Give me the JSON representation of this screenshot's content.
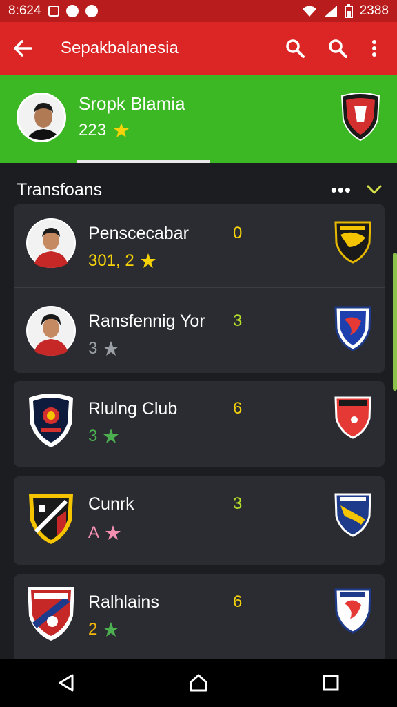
{
  "status_bar": {
    "time": "8:624",
    "right_text": "2388"
  },
  "app_bar": {
    "title": "Sepakbalanesia"
  },
  "profile": {
    "name": "Sropk Blamia",
    "rating": "223"
  },
  "section": {
    "title": "Transfoans"
  },
  "items": [
    {
      "name": "Penscecabar",
      "rating": "301, 2",
      "number": "0",
      "rating_color": "#f5d20a",
      "star_color": "#f5d20a",
      "number_color": "#f5d20a"
    },
    {
      "name": "Ransfennig Yor",
      "rating": "3",
      "number": "3",
      "rating_color": "#9aa0a6",
      "star_color": "#9aa0a6",
      "number_color": "#b5e02a"
    },
    {
      "name": "Rlulng Club",
      "rating": "3",
      "number": "6",
      "rating_color": "#4caf50",
      "star_color": "#4caf50",
      "number_color": "#f5d20a"
    },
    {
      "name": "Cunrk",
      "rating": "A",
      "number": "3",
      "rating_color": "#f48fb1",
      "star_color": "#f48fb1",
      "number_color": "#b5e02a"
    },
    {
      "name": "Ralhlains",
      "rating": "2",
      "number": "6",
      "rating_color": "#f5b70a",
      "star_color": "#4caf50",
      "number_color": "#f5d20a"
    }
  ],
  "colors": {
    "statusbar": "#b91c1c",
    "appbar": "#dc2626",
    "header": "#3cb824",
    "card": "#2a2c31",
    "star_gold": "#f5d20a"
  }
}
